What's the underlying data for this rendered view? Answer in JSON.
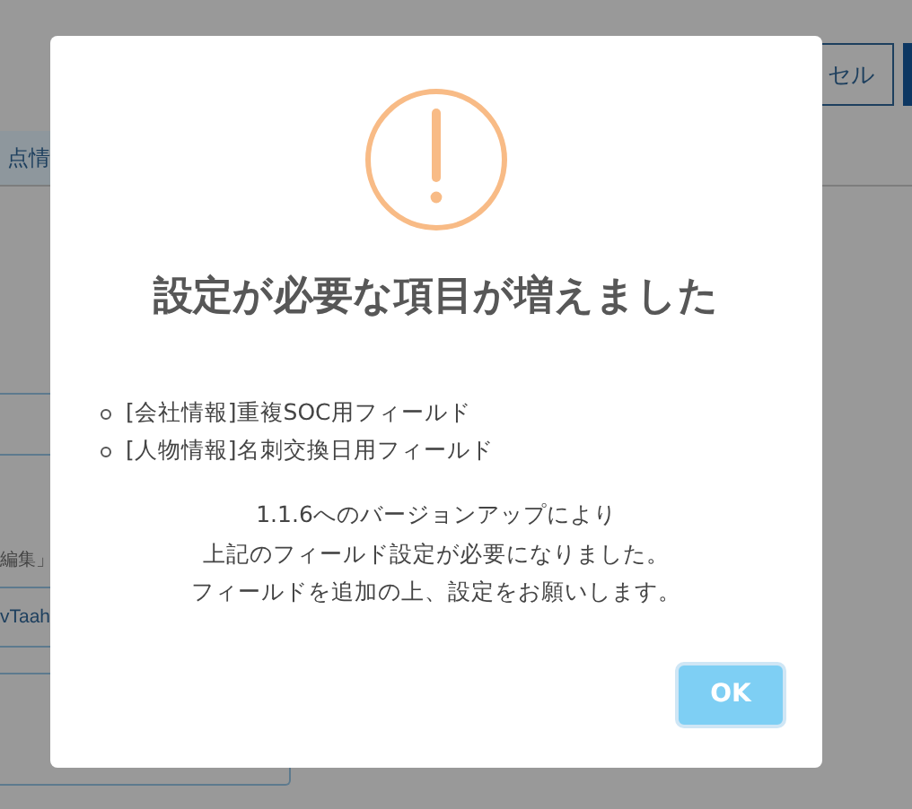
{
  "background": {
    "cancel_button": "セル",
    "tab": "点情",
    "label": "編集」",
    "field_value": "vTaah"
  },
  "dialog": {
    "title": "設定が必要な項目が増えました",
    "items": [
      "[会社情報]重複SOC用フィールド",
      "[人物情報]名刺交換日用フィールド"
    ],
    "message": [
      "1.1.6へのバージョンアップにより",
      "上記のフィールド設定が必要になりました。",
      "フィールドを追加の上、設定をお願いします。"
    ],
    "ok_button": "OK"
  }
}
